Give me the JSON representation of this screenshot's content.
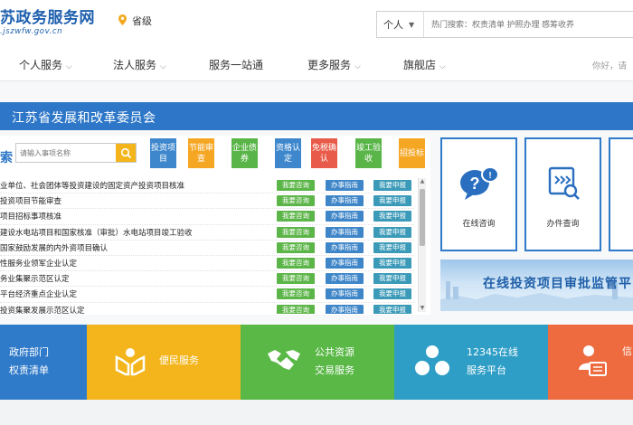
{
  "header": {
    "logo_text": "苏政务服务网",
    "logo_url": ".jszwfw.gov.cn",
    "location": "省级",
    "search_scope": "个人",
    "search_placeholder": "热门搜索：权责清单 护照办理 感筹收养"
  },
  "nav": {
    "items": [
      "个人服务",
      "法人服务",
      "服务一站通",
      "更多服务",
      "旗舰店"
    ],
    "greeting": "你好，请"
  },
  "dept": {
    "title": "江苏省发展和改革委员会"
  },
  "services": {
    "category_label": "索",
    "search_placeholder": "请输入事项名称",
    "categories": [
      {
        "label": "投资项目",
        "color": "#3e87cc"
      },
      {
        "label": "节能审查",
        "color": "#f5a623"
      },
      {
        "label": "企业债券",
        "color": "#59b548"
      },
      {
        "label": "资格认定",
        "color": "#3e87cc"
      },
      {
        "label": "免税确认",
        "color": "#e85b4a"
      },
      {
        "label": "竣工验收",
        "color": "#59b548"
      },
      {
        "label": "招投标",
        "color": "#f5a623"
      }
    ],
    "tag_labels": [
      "我要咨询",
      "办事指南",
      "我要申报"
    ],
    "items": [
      "业单位、社会团体等投资建设的固定资产投资项目核准",
      "投资项目节能审查",
      "项目招标事项核准",
      "建设水电站项目和国家核准（审批）水电站项目竣工验收",
      "国家鼓励发展的内外资项目确认",
      "性服务业领军企业认定",
      "务业集聚示范区认定",
      "平台经济重点企业认定",
      "投资集聚发展示范区认定"
    ]
  },
  "cards": [
    {
      "label": "在线咨询"
    },
    {
      "label": "办件查询"
    }
  ],
  "banner": {
    "text": "在线投资项目审批监管平台"
  },
  "tiles": [
    {
      "lines": [
        "政府部门",
        "权责清单"
      ],
      "color": "#2f7ac9"
    },
    {
      "lines": [
        "便民服务"
      ],
      "color": "#f3b51b"
    },
    {
      "lines": [
        "公共资源",
        "交易服务"
      ],
      "color": "#5ab847"
    },
    {
      "lines": [
        "12345在线",
        "服务平台"
      ],
      "color": "#2e9ec6"
    },
    {
      "lines": [
        "信"
      ],
      "color": "#ee6a3f"
    }
  ]
}
